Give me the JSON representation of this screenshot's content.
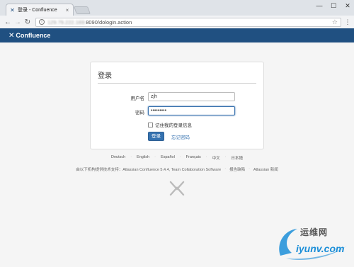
{
  "browser": {
    "tab_title": "登录 - Confluence",
    "tab_close": "×",
    "url_host": "129.79.222.169:",
    "url_path": "8090/dologin.action",
    "window_controls": [
      "—",
      "☐",
      "✕"
    ]
  },
  "header": {
    "logo_text": "Confluence",
    "brand_color": "#205081"
  },
  "login": {
    "title": "登录",
    "username_label": "用户名",
    "username_value": "zjh",
    "password_label": "密码",
    "password_value": "•••••••••",
    "remember_label": "记住我的登录信息",
    "submit_label": "登录",
    "forgot_label": "忘记密码",
    "accent_color": "#3572b0"
  },
  "languages": [
    "Deutsch",
    "English",
    "Español",
    "Français",
    "中文",
    "日本語"
  ],
  "footer": {
    "powered_by": "由以下机构提供技术支持：Atlassian Confluence 5.4.4, Team Collaboration Software",
    "report_bug": "报告缺陷",
    "news": "Atlassian 新闻"
  },
  "watermark": {
    "brand": "运维网",
    "domain": "iyunv.com"
  }
}
